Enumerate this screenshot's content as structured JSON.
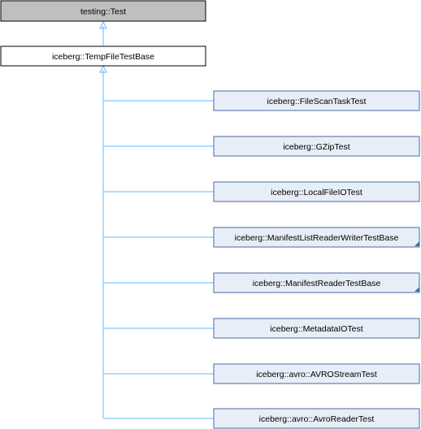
{
  "diagram": {
    "root_class": "testing::Test",
    "base_class": "iceberg::TempFileTestBase",
    "derived_classes": [
      {
        "label": "iceberg::FileScanTaskTest",
        "has_more": false
      },
      {
        "label": "iceberg::GZipTest",
        "has_more": false
      },
      {
        "label": "iceberg::LocalFileIOTest",
        "has_more": false
      },
      {
        "label": "iceberg::ManifestListReaderWriterTestBase",
        "has_more": true
      },
      {
        "label": "iceberg::ManifestReaderTestBase",
        "has_more": true
      },
      {
        "label": "iceberg::MetadataIOTest",
        "has_more": false
      },
      {
        "label": "iceberg::avro::AVROStreamTest",
        "has_more": false
      },
      {
        "label": "iceberg::avro::AvroReaderTest",
        "has_more": false
      }
    ],
    "colors": {
      "root_fill": "#bfbfbf",
      "base_fill": "#ffffff",
      "derived_fill": "#e8eef7",
      "node_border": "#000000",
      "derived_border": "#4a6aa5",
      "edge": "#63b8ff",
      "more_marker": "#4a6aa5"
    }
  }
}
